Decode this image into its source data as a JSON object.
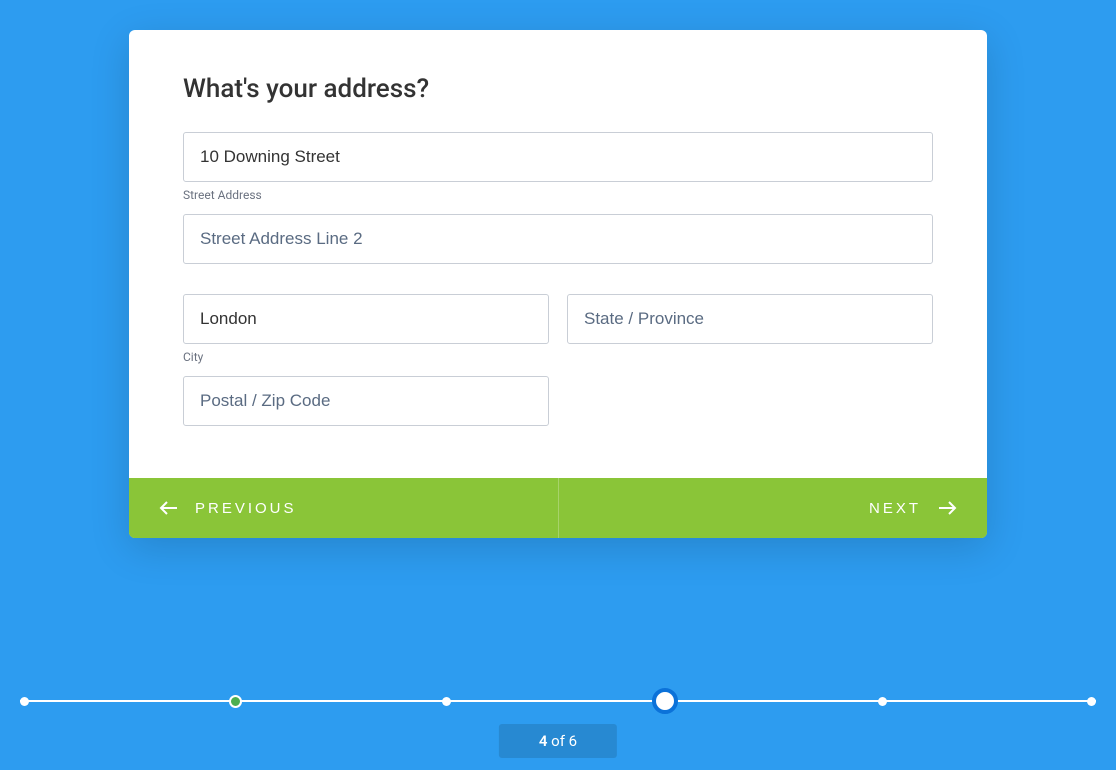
{
  "title": "What's your address?",
  "fields": {
    "street": {
      "value": "10 Downing Street",
      "placeholder": "Street Address",
      "label": "Street Address"
    },
    "street2": {
      "value": "",
      "placeholder": "Street Address Line 2"
    },
    "city": {
      "value": "London",
      "placeholder": "City",
      "label": "City"
    },
    "state": {
      "value": "",
      "placeholder": "State / Province"
    },
    "postal": {
      "value": "",
      "placeholder": "Postal / Zip Code"
    }
  },
  "nav": {
    "prev": "Previous",
    "next": "Next"
  },
  "progress": {
    "current": 4,
    "total": 6,
    "of_label": " of "
  },
  "colors": {
    "background": "#2d9cf0",
    "accent": "#8ac538",
    "step_done": "#4caf50",
    "step_current": "#0b72d9"
  }
}
